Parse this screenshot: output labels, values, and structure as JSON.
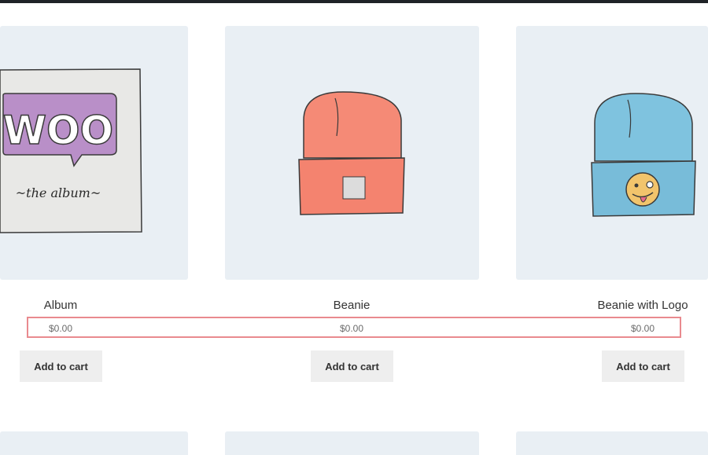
{
  "products": [
    {
      "title": "Album",
      "price": "$0.00",
      "button_label": "Add to cart",
      "image_icon": "woo-album-cover-icon",
      "album_logo_text": "WOO",
      "album_subtitle": "~the album~"
    },
    {
      "title": "Beanie",
      "price": "$0.00",
      "button_label": "Add to cart",
      "image_icon": "orange-beanie-icon"
    },
    {
      "title": "Beanie with Logo",
      "price": "$0.00",
      "button_label": "Add to cart",
      "image_icon": "blue-beanie-logo-icon"
    }
  ],
  "colors": {
    "tile_background": "#e9eff4",
    "button_background": "#eeeeee",
    "highlight_border": "#e98a8f",
    "top_bar": "#1f2327",
    "orange_beanie": "#f58a76",
    "blue_beanie": "#7fc3df",
    "album_purple": "#b98fc8"
  }
}
